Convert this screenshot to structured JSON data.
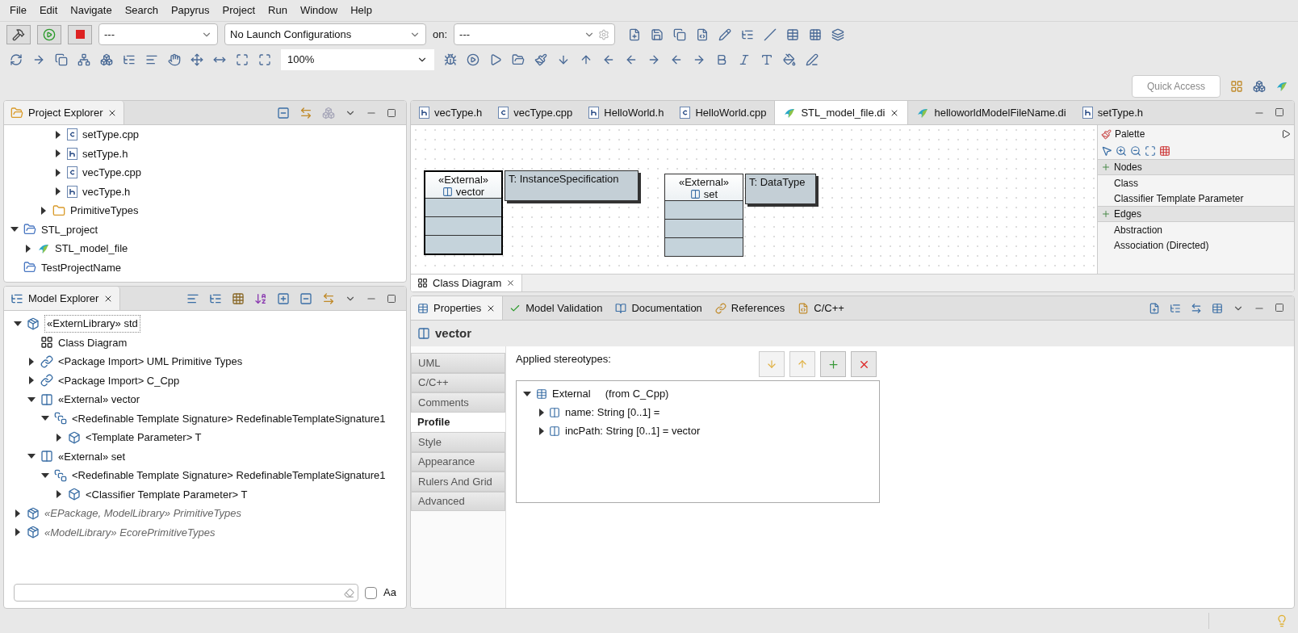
{
  "menu": [
    "File",
    "Edit",
    "Navigate",
    "Search",
    "Papyrus",
    "Project",
    "Run",
    "Window",
    "Help"
  ],
  "launch_bar": {
    "mode": "---",
    "configuration": "No Launch Configurations",
    "on_label": "on:",
    "target": "---"
  },
  "zoom": {
    "value": "100%"
  },
  "quick_access": {
    "placeholder": "Quick Access"
  },
  "project_explorer": {
    "title": "Project Explorer",
    "items": [
      {
        "label": "setType.cpp",
        "kind": "cpp",
        "expanded": false
      },
      {
        "label": "setType.h",
        "kind": "h",
        "expanded": false
      },
      {
        "label": "vecType.cpp",
        "kind": "cpp",
        "expanded": false
      },
      {
        "label": "vecType.h",
        "kind": "h",
        "expanded": false
      },
      {
        "label": "PrimitiveTypes",
        "kind": "folder",
        "expanded": false
      },
      {
        "label": "STL_project",
        "kind": "project",
        "expanded": true,
        "children": [
          {
            "label": "STL_model_file",
            "kind": "model",
            "expanded": false
          }
        ]
      },
      {
        "label": "TestProjectName",
        "kind": "project"
      }
    ]
  },
  "model_explorer": {
    "title": "Model Explorer",
    "items": [
      {
        "label": "«ExternLibrary» std",
        "kind": "package",
        "expanded": true,
        "dimmed": false,
        "children": [
          {
            "label": "Class Diagram",
            "kind": "diagram",
            "dimmed": false
          },
          {
            "label": "<Package Import> UML Primitive Types",
            "kind": "import",
            "expanded": false,
            "dimmed": false
          },
          {
            "label": "<Package Import> C_Cpp",
            "kind": "import",
            "expanded": false,
            "dimmed": false
          },
          {
            "label": "«External» vector",
            "kind": "class",
            "expanded": true,
            "dimmed": false,
            "children": [
              {
                "label": "<Redefinable Template Signature> RedefinableTemplateSignature1",
                "kind": "signature",
                "expanded": true,
                "dimmed": false,
                "children": [
                  {
                    "label": "<Template Parameter> T",
                    "kind": "parameter",
                    "expanded": false,
                    "dimmed": false
                  }
                ]
              }
            ]
          },
          {
            "label": "«External» set",
            "kind": "class",
            "expanded": true,
            "dimmed": false,
            "children": [
              {
                "label": "<Redefinable Template Signature> RedefinableTemplateSignature1",
                "kind": "signature",
                "expanded": true,
                "dimmed": false,
                "children": [
                  {
                    "label": "<Classifier Template Parameter> T",
                    "kind": "parameter",
                    "expanded": false,
                    "dimmed": false
                  }
                ]
              }
            ]
          }
        ]
      },
      {
        "label": "«EPackage, ModelLibrary» PrimitiveTypes",
        "kind": "package",
        "expanded": false,
        "dimmed": true
      },
      {
        "label": "«ModelLibrary» EcorePrimitiveTypes",
        "kind": "package",
        "expanded": false,
        "dimmed": true
      }
    ],
    "filter": {
      "case_label": "Aa",
      "checked": false
    }
  },
  "editor_tabs": [
    {
      "label": "vecType.h",
      "kind": "h",
      "selected": false
    },
    {
      "label": "vecType.cpp",
      "kind": "cpp",
      "selected": false
    },
    {
      "label": "HelloWorld.h",
      "kind": "h",
      "selected": false
    },
    {
      "label": "HelloWorld.cpp",
      "kind": "cpp",
      "selected": false
    },
    {
      "label": "STL_model_file.di",
      "kind": "model",
      "selected": true
    },
    {
      "label": "helloworldModelFileName.di",
      "kind": "model",
      "selected": false
    },
    {
      "label": "setType.h",
      "kind": "h",
      "selected": false
    }
  ],
  "diagram": {
    "nodes": [
      {
        "stereotype": "«External»",
        "name": "vector",
        "template": "T: InstanceSpecification",
        "selected": true
      },
      {
        "stereotype": "«External»",
        "name": "set",
        "template": "T: DataType",
        "selected": false
      }
    ],
    "tab": "Class Diagram"
  },
  "palette": {
    "title": "Palette",
    "groups": [
      {
        "title": "Nodes",
        "items": [
          "Class",
          "Classifier Template Parameter"
        ]
      },
      {
        "title": "Edges",
        "items": [
          "Abstraction",
          "Association (Directed)"
        ]
      }
    ]
  },
  "properties": {
    "tabs": [
      {
        "label": "Properties",
        "selected": true
      },
      {
        "label": "Model Validation",
        "selected": false
      },
      {
        "label": "Documentation",
        "selected": false
      },
      {
        "label": "References",
        "selected": false
      },
      {
        "label": "C/C++",
        "selected": false
      }
    ],
    "element": "vector",
    "sections": [
      {
        "label": "UML",
        "selected": false
      },
      {
        "label": "C/C++",
        "selected": false
      },
      {
        "label": "Comments",
        "selected": false
      },
      {
        "label": "Profile",
        "selected": true
      },
      {
        "label": "Style",
        "selected": false
      },
      {
        "label": "Appearance",
        "selected": false
      },
      {
        "label": "Rulers And Grid",
        "selected": false
      },
      {
        "label": "Advanced",
        "selected": false
      }
    ],
    "stereotypes_label": "Applied stereotypes:",
    "stereotypes": [
      {
        "label": "External",
        "note": "(from C_Cpp)",
        "expanded": true,
        "children": [
          {
            "label": "name: String [0..1] =",
            "expanded": false
          },
          {
            "label": "incPath: String [0..1] = vector",
            "expanded": false
          }
        ]
      }
    ]
  }
}
